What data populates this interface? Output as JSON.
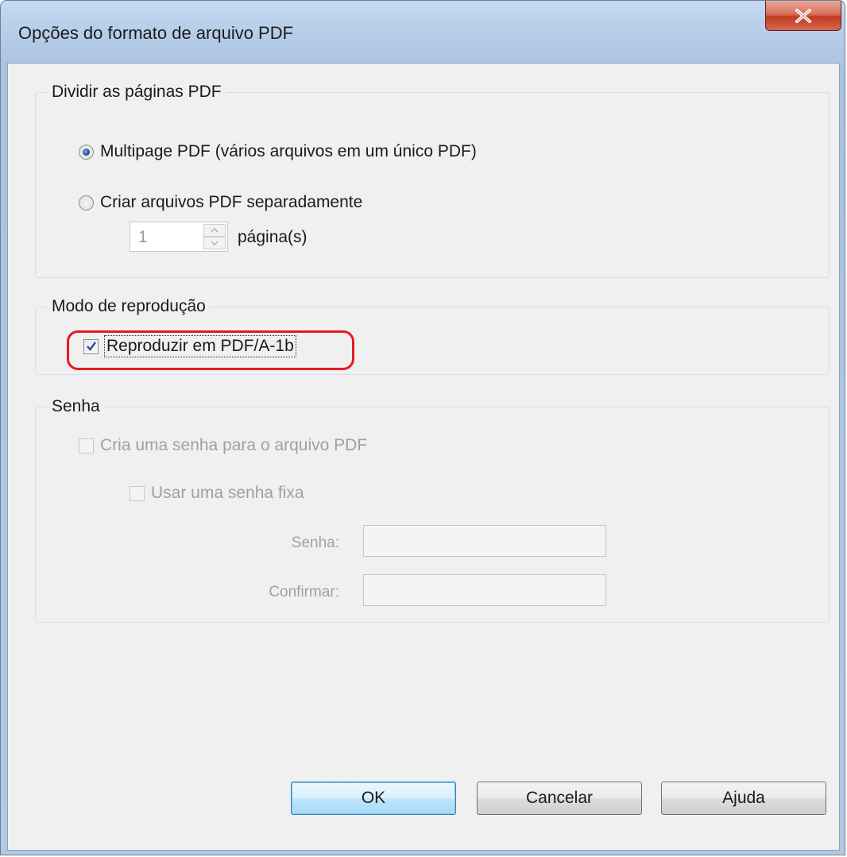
{
  "window": {
    "title": "Opções do formato de arquivo PDF",
    "close_icon": "close-icon"
  },
  "split_group": {
    "label": "Dividir as páginas PDF",
    "options": [
      {
        "label": "Multipage PDF (vários arquivos em um único PDF)",
        "selected": true
      },
      {
        "label": "Criar arquivos PDF separadamente",
        "selected": false
      }
    ],
    "pages_value": "1",
    "pages_unit": "página(s)"
  },
  "render_group": {
    "label": "Modo de reprodução",
    "pdfa_label": "Reproduzir em PDF/A-1b",
    "pdfa_checked": true
  },
  "password_group": {
    "label": "Senha",
    "create_password_label": "Cria uma senha para o arquivo PDF",
    "fixed_password_label": "Usar uma senha fixa",
    "password_label": "Senha:",
    "confirm_label": "Confirmar:",
    "password_value": "",
    "confirm_value": ""
  },
  "buttons": {
    "ok": "OK",
    "cancel": "Cancelar",
    "help": "Ajuda"
  },
  "colors": {
    "highlight": "#e31b23",
    "radio_selected": "#1b4f9c"
  }
}
